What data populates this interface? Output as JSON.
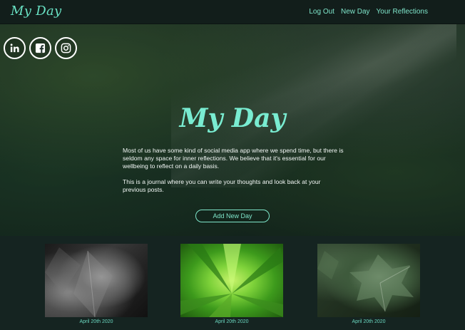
{
  "navbar": {
    "brand": "My Day",
    "links": [
      "Log Out",
      "New Day",
      "Your Reflections"
    ]
  },
  "social": [
    "linkedin-icon",
    "facebook-icon",
    "instagram-icon"
  ],
  "hero": {
    "title": "My Day",
    "paragraphs": [
      "Most of us have some kind of social media app where we spend time, but there is seldom any space for inner reflections. We believe that it's essential for our wellbeing to reflect on a daily basis.",
      "This is a journal where you can write your thoughts and look back at your previous posts."
    ],
    "button": "Add New Day"
  },
  "cards": [
    {
      "date": "April 20th 2020"
    },
    {
      "date": "April 20th 2020"
    },
    {
      "date": "April 20th 2020"
    }
  ],
  "colors": {
    "accent": "#79ecd1",
    "background": "#152421",
    "navbar": "#121e1b"
  }
}
